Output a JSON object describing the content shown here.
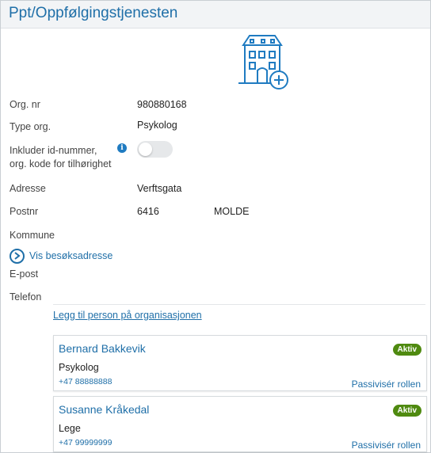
{
  "header": {
    "title": "Ppt/Oppfølgingstjenesten"
  },
  "icons": {
    "building": "building-add-icon",
    "info": "info-icon",
    "chevron": "chevron-right-circle-icon"
  },
  "fields": {
    "org_nr_label": "Org. nr",
    "org_nr_value": "980880168",
    "type_label": "Type org.",
    "type_value": "Psykolog",
    "include_label_1": "Inkluder id-nummer,",
    "include_label_2": "org. kode for tilhørighet",
    "include_toggle_on": false,
    "address_label": "Adresse",
    "address_value": "Verftsgata",
    "postnr_label": "Postnr",
    "postnr_value": "6416",
    "city_value": "MOLDE",
    "kommune_label": "Kommune",
    "visit_address_link": "Vis besøksadresse",
    "email_label": "E-post",
    "phone_label": "Telefon"
  },
  "add_person_link": "Legg til person på organisasjonen",
  "persons": [
    {
      "name": "Bernard Bakkevik",
      "status": "Aktiv",
      "role": "Psykolog",
      "phone": "+47 88888888",
      "action": "Passivisér rollen"
    },
    {
      "name": "Susanne Kråkedal",
      "status": "Aktiv",
      "role": "Lege",
      "phone": "+47 99999999",
      "action": "Passivisér rollen"
    }
  ],
  "colors": {
    "accent": "#1f6fa8",
    "badge": "#4f8a10",
    "header_bg": "#f2f4f6"
  }
}
